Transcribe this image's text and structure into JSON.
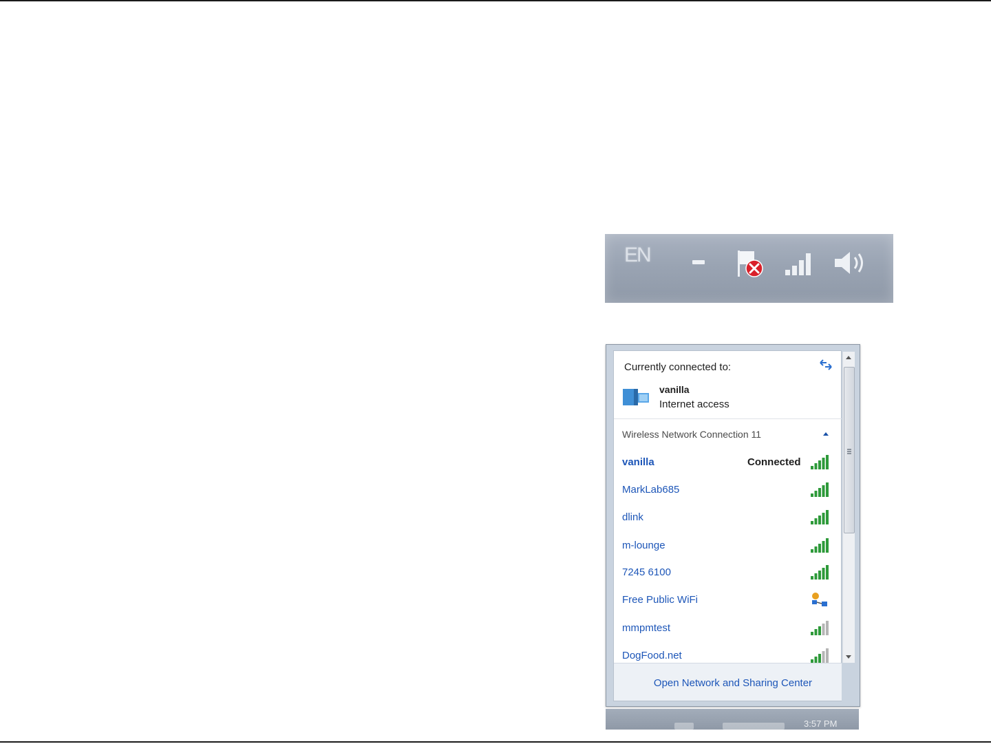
{
  "tray": {
    "language": "EN",
    "icons": [
      "minus-icon",
      "action-center-flag-error-icon",
      "signal-bars-icon",
      "speaker-icon"
    ]
  },
  "popup": {
    "connected_label": "Currently connected to:",
    "current_network": {
      "name": "vanilla",
      "status": "Internet access"
    },
    "section_title": "Wireless Network Connection 11",
    "networks": [
      {
        "name": "vanilla",
        "status": "Connected",
        "signal": 5,
        "icon": "signal-bars-icon"
      },
      {
        "name": "MarkLab685",
        "status": "",
        "signal": 5,
        "icon": "signal-bars-icon"
      },
      {
        "name": "dlink",
        "status": "",
        "signal": 5,
        "icon": "signal-bars-icon"
      },
      {
        "name": "m-lounge",
        "status": "",
        "signal": 5,
        "icon": "signal-bars-icon"
      },
      {
        "name": "7245 6100",
        "status": "",
        "signal": 5,
        "icon": "signal-bars-icon"
      },
      {
        "name": "Free Public WiFi",
        "status": "",
        "signal": 0,
        "icon": "adhoc-network-icon"
      },
      {
        "name": "mmpmtest",
        "status": "",
        "signal": 3,
        "icon": "signal-bars-icon"
      },
      {
        "name": "DogFood.net",
        "status": "",
        "signal": 3,
        "icon": "signal-bars-icon"
      }
    ],
    "footer_link": "Open Network and Sharing Center"
  },
  "taskbar": {
    "clock": "3:57 PM"
  },
  "colors": {
    "link_blue": "#1d56b8",
    "signal_green": "#2e9a3a",
    "signal_grey": "#b5b5b5",
    "tray_bg": "#9aa4b3"
  }
}
